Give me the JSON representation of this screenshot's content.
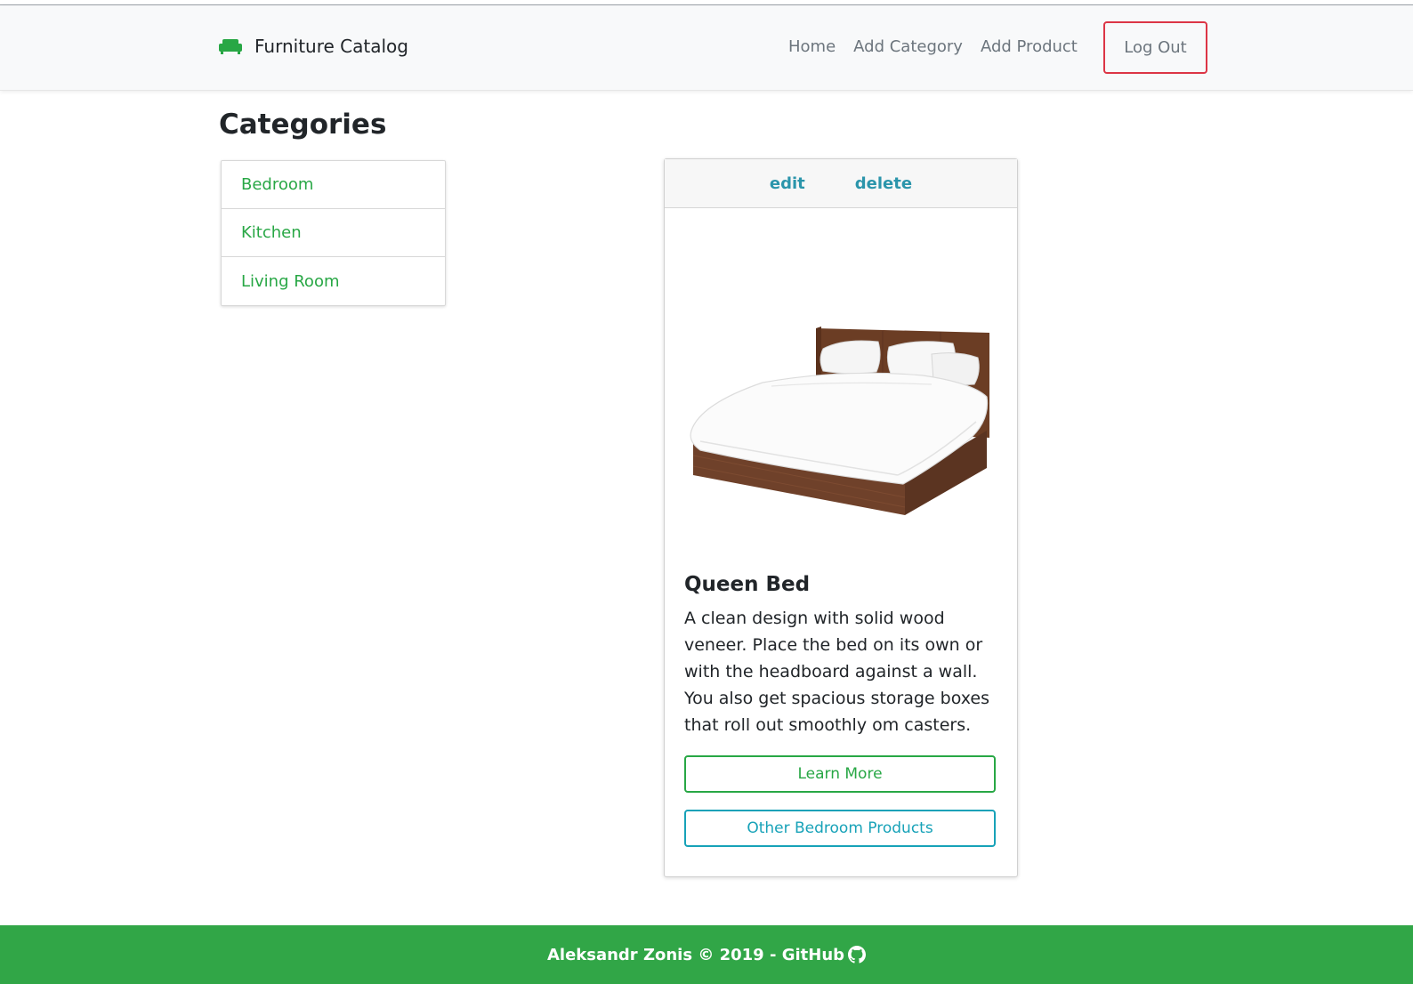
{
  "navbar": {
    "brand": "Furniture Catalog",
    "brand_icon": "couch-icon",
    "links": [
      "Home",
      "Add Category",
      "Add Product"
    ],
    "logout": "Log Out"
  },
  "main": {
    "title": "Categories",
    "categories": [
      "Bedroom",
      "Kitchen",
      "Living Room"
    ]
  },
  "product": {
    "edit": "edit",
    "delete": "delete",
    "image": "bed-image",
    "name": "Queen Bed",
    "description": "A clean design with solid wood veneer. Place the bed on its own or with the headboard against a wall. You also get spacious storage boxes that roll out smoothly om casters.",
    "learn_more": "Learn More",
    "other_products": "Other Bedroom Products"
  },
  "footer": {
    "text": "Aleksandr Zonis © 2019 - GitHub",
    "icon": "github-icon"
  },
  "colors": {
    "accent_green": "#28a745",
    "accent_blue": "#17a2b8",
    "danger_red": "#dc3545",
    "footer_bg": "#31a647"
  }
}
